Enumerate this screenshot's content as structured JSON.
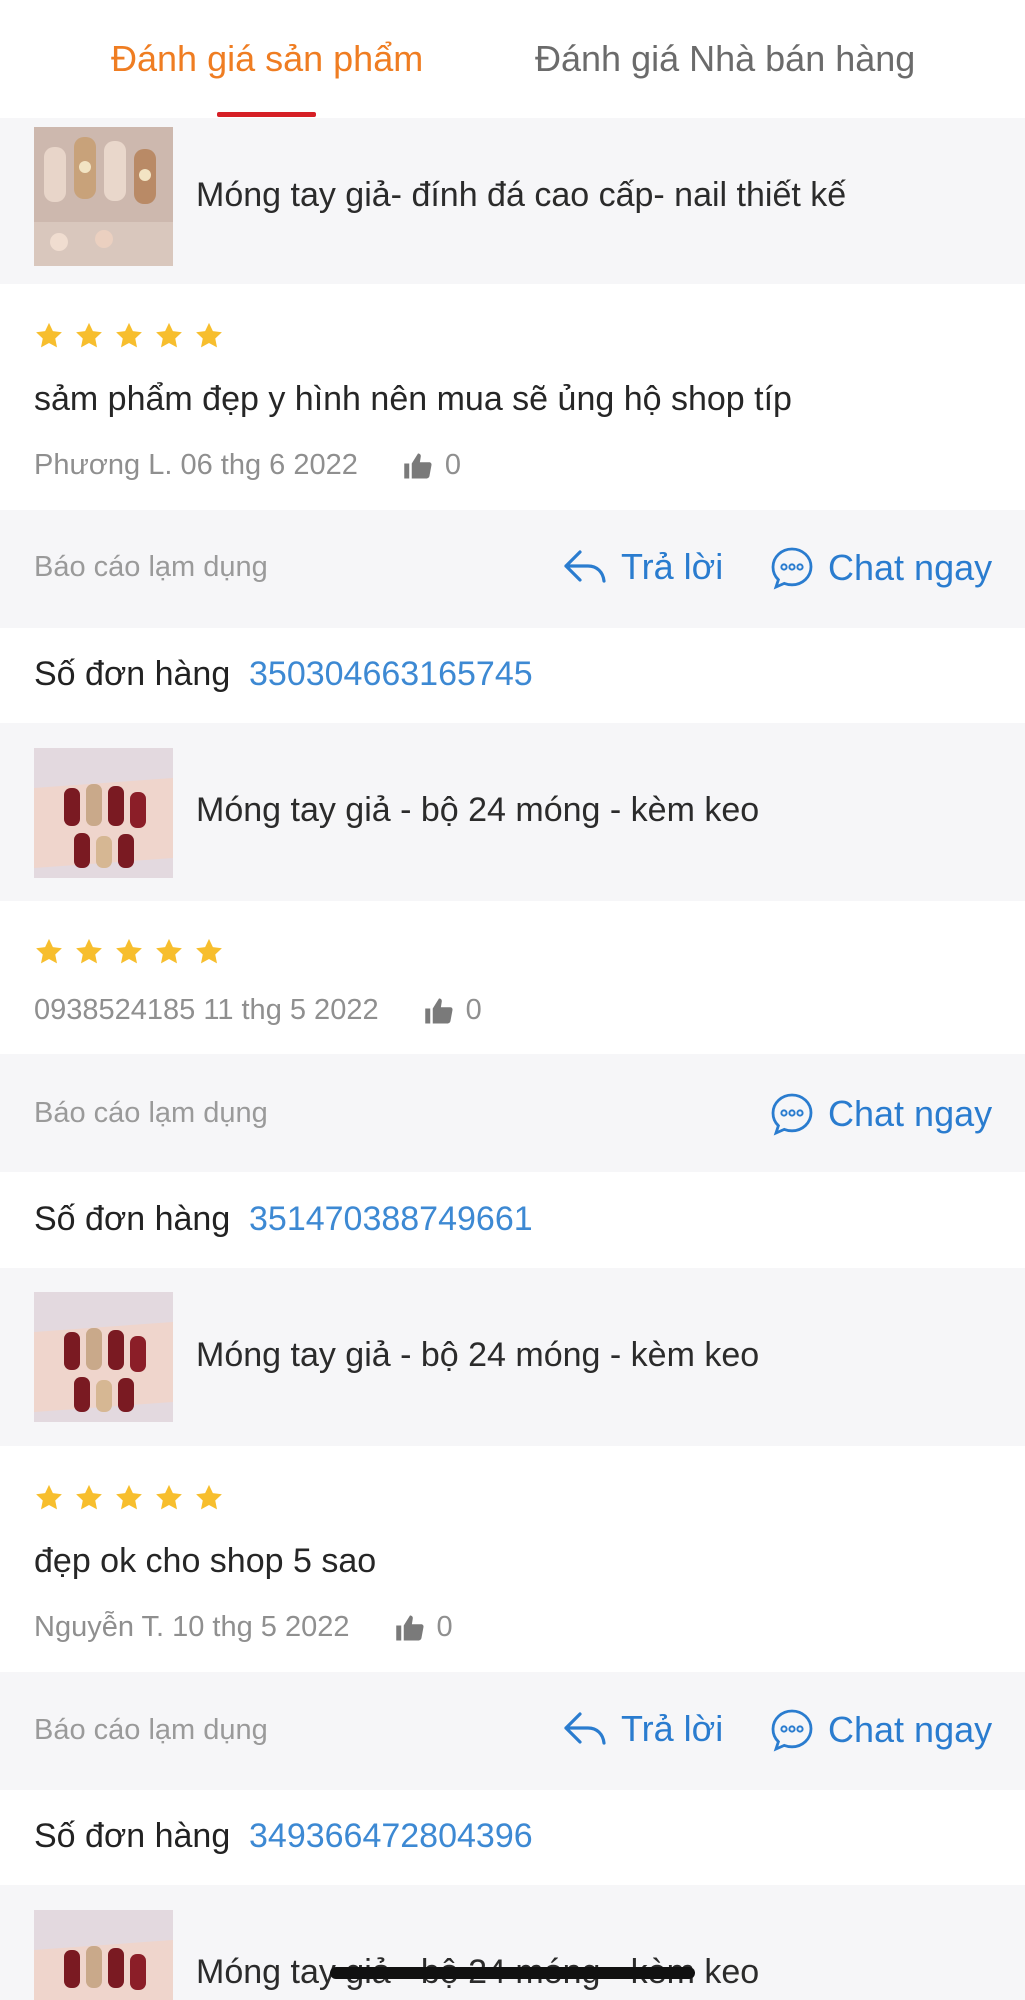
{
  "tabs": {
    "product_reviews": "Đánh giá sản phẩm",
    "seller_reviews": "Đánh giá Nhà bán hàng"
  },
  "colors": {
    "accent_orange": "#ef7d22",
    "underline_red": "#d61f26",
    "link_blue": "#2a7ccf",
    "star_yellow": "#f7be2d"
  },
  "reviews": [
    {
      "product_name": "Móng tay giả- đính đá cao cấp- nail thiết kế",
      "rating": 5,
      "text": "sảm phẩm đẹp y hình nên mua sẽ ủng hộ shop típ",
      "meta": "Phương L. 06 thg 6 2022",
      "likes": "0",
      "report": "Báo cáo lạm dụng",
      "reply": "Trả lời",
      "chat": "Chat ngay",
      "order_label": "Số đơn hàng",
      "order_number": "350304663165745"
    },
    {
      "product_name": "Móng tay giả - bộ 24 móng - kèm keo",
      "rating": 5,
      "meta": "0938524185 11 thg 5 2022",
      "likes": "0",
      "report": "Báo cáo lạm dụng",
      "chat": "Chat ngay",
      "order_label": "Số đơn hàng",
      "order_number": "351470388749661"
    },
    {
      "product_name": "Móng tay giả - bộ 24 móng - kèm keo",
      "rating": 5,
      "text": "đẹp ok cho shop 5 sao",
      "meta": "Nguyễn T. 10 thg 5 2022",
      "likes": "0",
      "report": "Báo cáo lạm dụng",
      "reply": "Trả lời",
      "chat": "Chat ngay",
      "order_label": "Số đơn hàng",
      "order_number": "349366472804396"
    },
    {
      "product_name": "Móng tay giả - bộ 24 móng - kèm keo"
    }
  ]
}
